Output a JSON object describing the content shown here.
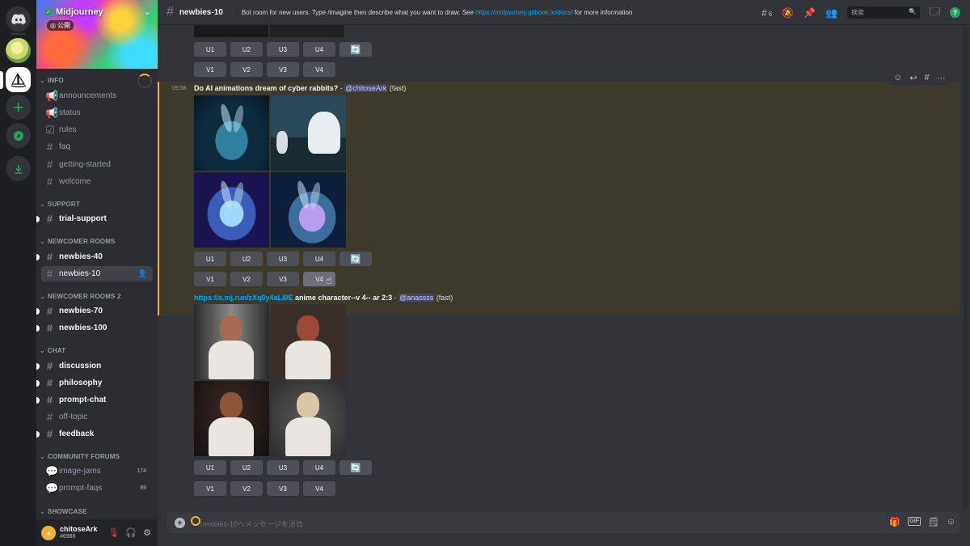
{
  "server": {
    "name": "Midjourney",
    "badge": "公開"
  },
  "categories": [
    {
      "label": "INFO"
    },
    {
      "label": "SUPPORT"
    },
    {
      "label": "NEWCOMER ROOMS"
    },
    {
      "label": "NEWCOMER ROOMS 2"
    },
    {
      "label": "CHAT"
    },
    {
      "label": "COMMUNITY FORUMS"
    },
    {
      "label": "SHOWCASE"
    }
  ],
  "channels": [
    {
      "label": "announcements"
    },
    {
      "label": "status"
    },
    {
      "label": "rules"
    },
    {
      "label": "faq"
    },
    {
      "label": "getting-started"
    },
    {
      "label": "welcome"
    },
    {
      "label": "trial-support"
    },
    {
      "label": "newbies-40"
    },
    {
      "label": "newbies-10"
    },
    {
      "label": "newbies-70"
    },
    {
      "label": "newbies-100"
    },
    {
      "label": "discussion"
    },
    {
      "label": "philosophy"
    },
    {
      "label": "prompt-chat"
    },
    {
      "label": "off-topic"
    },
    {
      "label": "feedback"
    },
    {
      "label": "image-jams",
      "count": "174"
    },
    {
      "label": "prompt-faqs",
      "count": "89"
    }
  ],
  "user": {
    "name": "chitoseArk",
    "tag": "#6988"
  },
  "topbar": {
    "channel": "newbies-10",
    "topic_pre": "Bot room for new users. Type /imagine then describe what you want to draw. See ",
    "topic_link": "https://midjourney.gitbook.io/docs/",
    "topic_post": " for more information",
    "thread_count": "6",
    "search_placeholder": "検索"
  },
  "buttons": {
    "u1": "U1",
    "u2": "U2",
    "u3": "U3",
    "u4": "U4",
    "v1": "V1",
    "v2": "V2",
    "v3": "V3",
    "v4": "V4",
    "reroll": "🔄"
  },
  "messages": [
    {
      "time": "09:58",
      "prompt": "Do AI animations dream of cyber rabbits?",
      "sep": " - ",
      "mention": "@chitoseArk",
      "speed": " (fast)"
    },
    {
      "link": "https://s.mj.run/zXq0y4aLi0E",
      "prompt": " anime character--v 4-- ar 2:3",
      "sep": " - ",
      "mention": "@anassss",
      "speed": " (fast)"
    }
  ],
  "composer": {
    "placeholder": "newbies-10へメッセージを送信"
  }
}
